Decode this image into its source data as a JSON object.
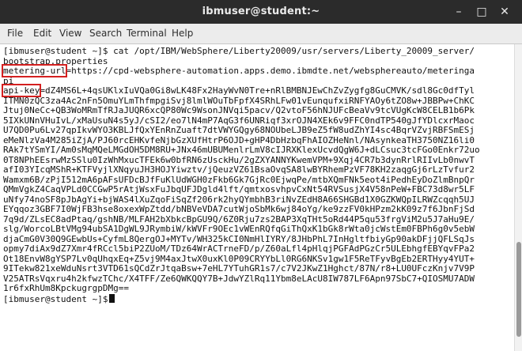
{
  "window": {
    "title": "ibmuser@student:~"
  },
  "menubar": {
    "items": [
      "File",
      "Edit",
      "View",
      "Search",
      "Terminal",
      "Help"
    ]
  },
  "terminal": {
    "command_line": "[ibmuser@student ~]$ cat /opt/IBM/WebSphere/Liberty20009/usr/servers/Liberty_20009_server/",
    "command_wrap": "bootstrap.properties",
    "metering_key": "metering-url",
    "metering_rest": "=https://cpd-websphere-automation.apps.demo.ibmdte.net/websphereauto/meteringa",
    "metering_wrap": "pi",
    "api_key_key": "api-key",
    "api_key_rest": "=dZ4MS6L+4qsUKlxIuVQa0Gi8wLK48Fx2HayWvN0Tre+nRlBMBNJEwChZvZygfg8GuCMVK/sdl8Gc0dfTyl",
    "api_key_lines": [
      "ITMN0zQC3za4Ac2nFn5OmuYLmThfmpgiSvj8lmlWOuTbFpfX4SRhLFw01vEunqufxiRNFYAOy6tZO8w+JBBPw+ChKC",
      "Jtuj0NeCc+QB3WoMRmTfRJaJUQR6xcQP80Wc9WsonJNVqi5pacv/Q2vtoF56hNJUFcBeaVv9tcVUgKcW8CELB1b6Pk",
      "5IXkUNnVHuIvL/xMaUsuN4s5yJ/cSI2/eo7lN4mP7AqG3f6UNRiqf3xrOJN4XEk6v9FFC0ndTP540gJfYDlcxrMaoc",
      "U7QD0Pu6Lv27qpIkvWYO3KBLJfQxYEnRnZuaft7dtVWYGQgy68NOUbeLJB9eZ5fW8udZhYI4sc4BqrVZvjRBFSmESj",
      "eMeNlzVa4M285iZjA/PJ60rcEHKvfeNjbGzXUfHtrP6OJD+gHP4DbHzbqFhAIOZHeNnl/NAsynkeaTH3750NZ16li0",
      "RAk7tYSmYI/Am0sMqMQeLMGdOH5DM8RU+JNx46mUBUMenlrLmV8cIJRXKlexUcvdQgW6J+dLCsuc3tcFGo0Enkr72uo",
      "0T8NPhEEsrwMzSSlu0IzWhMxucTFEk6w0bfRN6zUsckHu/2gZXYANNYKwemVPM+9Xqj4CR7b3dynRrlRIIvLb0nwvT",
      "afI03YIcqMShR+KTFVyjlXNqyuJH3HOJYiwztv/jQeuzVZ61BsaOvqSA8lwBYRhemPzVF78KH2zaqgGj6rLzTvfur2",
      "Wamxm6B/zPjI512mA6pAFsUFDcBJfFuKlUdWGH0zFkb6Gk7GjRc0EjwqPe/mtbXQmFNk5eot4iPedhEyDoZlmBnpQr",
      "QMmVgkZ4CaqVPLd0CCGwP5rAtjWsxFuJbqUFJDgld4lft/qmtxosvhpvCxNt54RVSusjX4V58nPeW+FBC73d8wr5LF",
      "uNfy74noSF8pJbAgYi+bjWAS4lXuZqoFiSqZf206rk2hyQYmbhB3riNvZEdH8A66SHGBd1X0GZKWQpILRWZcqqh5UJ",
      "EYqqoz3GBF7I0WjFB3hse8oxexWpZtdd/bNBVeVDA7cutWjoSbMk6wj84oYg/ke9zzFV0kHPzm2kK09z7f6JbnFjSd",
      "7q9d/ZLsEC8adPtaq/gshNB/MLFAH2bXbkcBpGU9Q/6Z0Rju7zs2BAP3XqTHt5oRd44P5qu53frgViM2u5J7aHu9E/",
      "slg/WorcoLBtVMg94ubSA1DgWL9JRymbiW/kWVFr9OEc1vWEnRQfqGiThQxK1bGk8rWta0jcWstEm0FBPh6g0v5ebW",
      "djaCmG0V30Q9GEwbUs+CyfmL8QergOJ+MYTv/WH325kCI0NmHlIYRY/8JHbPhL7InHgltfbiyGp90akDFjjQFLSqJs",
      "opmy7diAx9dZ7Xmr4fRCcl5biP2ZUoM/TDz64WrACTrneFD/p/Z60aLfl4pHlqjPGFAdPGzCr5ULEbhgfEBYqvFPa2",
      "Ot18EnvW8gYSP7Lv0qUhqxEq+Z5vj9M4axJtwX0uxKl0P09CRYYbLl0RG6NKSv1gw1F5ReTFyvBgEb2ERTHyy4YUT+",
      "9ITekw821xeWduNsrt3VTD61sQCdZrJtqaBsw+7eHL7YTuhGR1s7/c7V2JKwZ1Hghct/87N/r8+LU0UFczKnjv7V9P",
      "V25ATRsVqxru4h2kfwzTChc/X4TFF/Ze6QWKQQY7B+JdwYZlRq11Ybm8eLAcU8IW787LF6Apn97SbC7+QIOSMU7ADW",
      "1r6fxRhUm8KpckugrgpDMg=="
    ],
    "final_prompt": "[ibmuser@student ~]$"
  },
  "colors": {
    "highlight": "#d42020",
    "titlebar": "#2b2b2b"
  }
}
